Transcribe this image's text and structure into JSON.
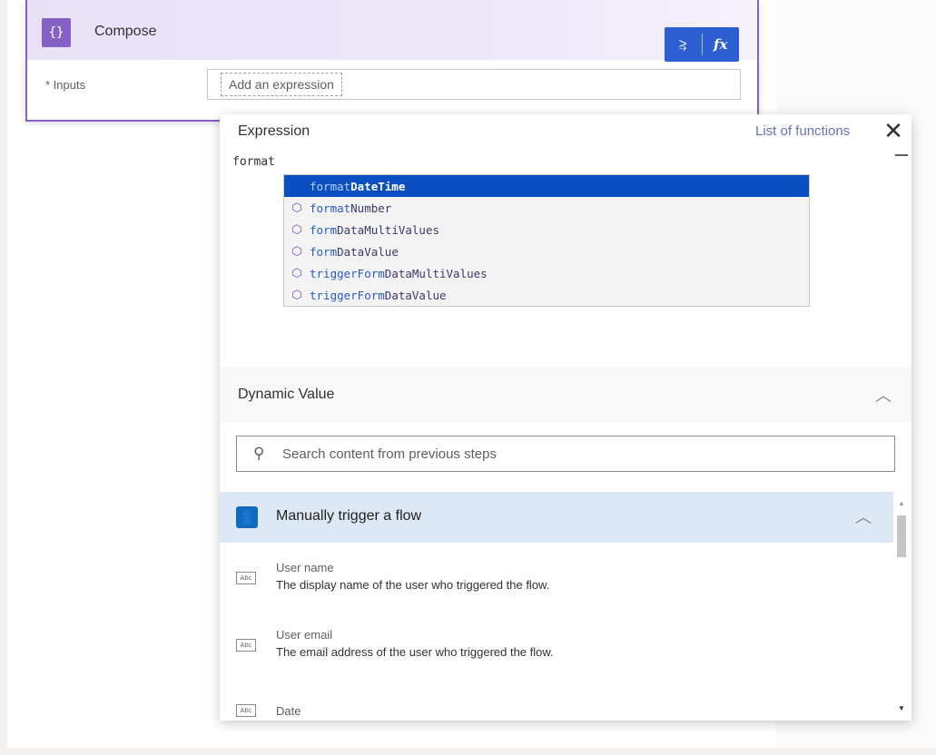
{
  "compose": {
    "icon": "{}",
    "title": "Compose",
    "inputs_label": "* Inputs",
    "expression_token": "Add an expression",
    "toggle_dynamic_icon": "⥸",
    "toggle_fx_icon": "fx"
  },
  "expression_panel": {
    "title": "Expression",
    "list_of_functions": "List of functions",
    "close_icon": "✕",
    "editor_text": "format",
    "suggestions": [
      {
        "match": "format",
        "rest": "DateTime",
        "selected": true
      },
      {
        "match": "format",
        "rest": "Number",
        "selected": false
      },
      {
        "match": "form",
        "rest": "DataMultiValues",
        "selected": false
      },
      {
        "match": "form",
        "rest": "DataValue",
        "selected": false
      },
      {
        "match": "triggerForm",
        "rest": "DataMultiValues",
        "selected": false
      },
      {
        "match": "triggerForm",
        "rest": "DataValue",
        "selected": false
      }
    ]
  },
  "dynamic_value": {
    "title": "Dynamic Value",
    "search_placeholder": "Search content from previous steps",
    "trigger": {
      "title": "Manually trigger a flow",
      "items": [
        {
          "name": "User name",
          "description": "The display name of the user who triggered the flow."
        },
        {
          "name": "User email",
          "description": "The email address of the user who triggered the flow."
        },
        {
          "name": "Date",
          "description": ""
        }
      ]
    }
  },
  "colors": {
    "accent_purple": "#8661c5",
    "toggle_blue": "#2d5fd3",
    "selection_blue": "#0a4fc2",
    "trigger_blue": "#0f6cbd"
  }
}
